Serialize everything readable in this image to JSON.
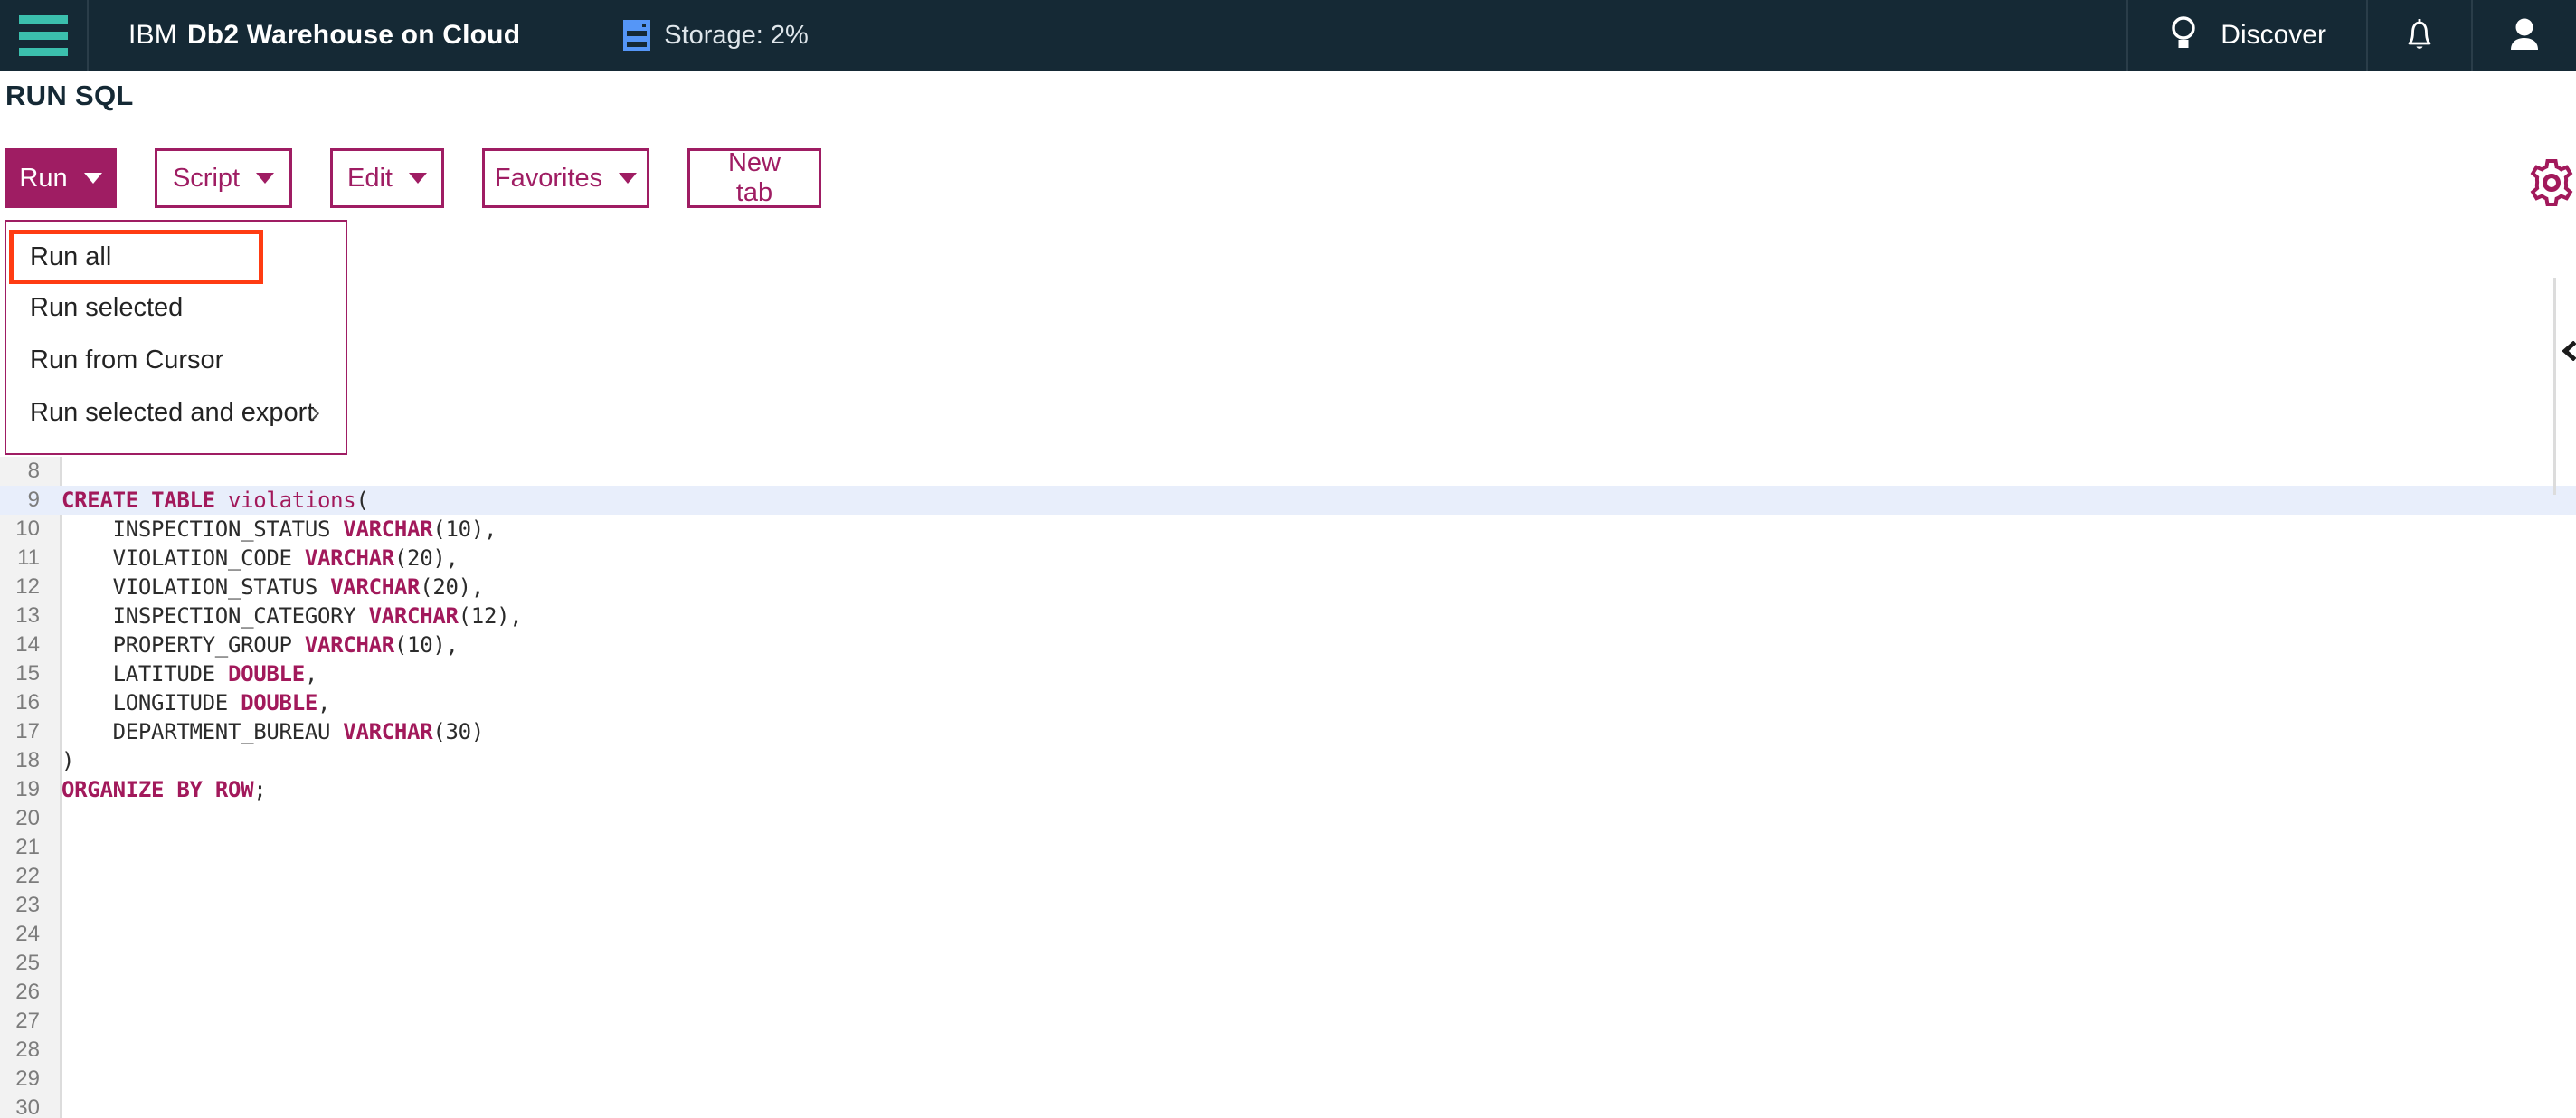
{
  "nav": {
    "hamburger_icon": "hamburger-menu-icon",
    "brand_prefix": "IBM",
    "brand_name": "Db2 Warehouse on Cloud",
    "storage_icon": "database-storage-icon",
    "storage_label": "Storage: 2%",
    "discover_icon": "lightbulb-icon",
    "discover_label": "Discover",
    "notifications_icon": "bell-icon",
    "profile_icon": "user-avatar-icon",
    "background_color": "#152935",
    "accent_color": "#3bbfad"
  },
  "page": {
    "title": "RUN SQL"
  },
  "toolbar": {
    "accent_color": "#9f1d63",
    "buttons": [
      {
        "label": "Run",
        "has_caret": true,
        "variant": "primary"
      },
      {
        "label": "Script",
        "has_caret": true,
        "variant": "outline"
      },
      {
        "label": "Edit",
        "has_caret": true,
        "variant": "outline"
      },
      {
        "label": "Favorites",
        "has_caret": true,
        "variant": "outline"
      },
      {
        "label": "New tab",
        "has_caret": false,
        "variant": "outline"
      }
    ],
    "settings_icon": "gear-icon"
  },
  "run_menu": {
    "open": true,
    "focus_outline_color": "#ff3c12",
    "items": [
      {
        "label": "Run all",
        "focused": true,
        "submenu": false
      },
      {
        "label": "Run selected",
        "focused": false,
        "submenu": false
      },
      {
        "label": "Run from Cursor",
        "focused": false,
        "submenu": false
      },
      {
        "label": "Run selected and export",
        "focused": false,
        "submenu": true,
        "submenu_glyph": "›"
      }
    ]
  },
  "editor": {
    "first_visible_line": 8,
    "last_visible_line": 30,
    "highlighted_line": 9,
    "highlight_color": "#e8eefb",
    "gutter_color": "#f2f2f2",
    "collapse_icon": "chevron-left-icon",
    "lines": [
      {
        "n": 8,
        "text": ""
      },
      {
        "n": 9,
        "text": "CREATE TABLE violations("
      },
      {
        "n": 10,
        "text": "    INSPECTION_STATUS VARCHAR(10),"
      },
      {
        "n": 11,
        "text": "    VIOLATION_CODE VARCHAR(20),"
      },
      {
        "n": 12,
        "text": "    VIOLATION_STATUS VARCHAR(20),"
      },
      {
        "n": 13,
        "text": "    INSPECTION_CATEGORY VARCHAR(12),"
      },
      {
        "n": 14,
        "text": "    PROPERTY_GROUP VARCHAR(10),"
      },
      {
        "n": 15,
        "text": "    LATITUDE DOUBLE,"
      },
      {
        "n": 16,
        "text": "    LONGITUDE DOUBLE,"
      },
      {
        "n": 17,
        "text": "    DEPARTMENT_BUREAU VARCHAR(30)"
      },
      {
        "n": 18,
        "text": ")"
      },
      {
        "n": 19,
        "text": "ORGANIZE BY ROW;"
      },
      {
        "n": 20,
        "text": ""
      },
      {
        "n": 21,
        "text": ""
      },
      {
        "n": 22,
        "text": ""
      },
      {
        "n": 23,
        "text": ""
      },
      {
        "n": 24,
        "text": ""
      },
      {
        "n": 25,
        "text": ""
      },
      {
        "n": 26,
        "text": ""
      },
      {
        "n": 27,
        "text": ""
      },
      {
        "n": 28,
        "text": ""
      },
      {
        "n": 29,
        "text": ""
      },
      {
        "n": 30,
        "text": ""
      }
    ]
  }
}
